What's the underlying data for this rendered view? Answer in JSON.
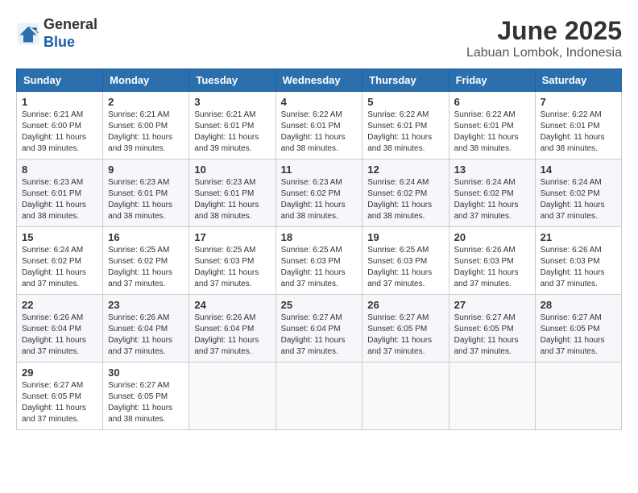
{
  "header": {
    "logo_line1": "General",
    "logo_line2": "Blue",
    "month_year": "June 2025",
    "location": "Labuan Lombok, Indonesia"
  },
  "weekdays": [
    "Sunday",
    "Monday",
    "Tuesday",
    "Wednesday",
    "Thursday",
    "Friday",
    "Saturday"
  ],
  "weeks": [
    [
      {
        "day": "1",
        "info": "Sunrise: 6:21 AM\nSunset: 6:00 PM\nDaylight: 11 hours\nand 39 minutes."
      },
      {
        "day": "2",
        "info": "Sunrise: 6:21 AM\nSunset: 6:00 PM\nDaylight: 11 hours\nand 39 minutes."
      },
      {
        "day": "3",
        "info": "Sunrise: 6:21 AM\nSunset: 6:01 PM\nDaylight: 11 hours\nand 39 minutes."
      },
      {
        "day": "4",
        "info": "Sunrise: 6:22 AM\nSunset: 6:01 PM\nDaylight: 11 hours\nand 38 minutes."
      },
      {
        "day": "5",
        "info": "Sunrise: 6:22 AM\nSunset: 6:01 PM\nDaylight: 11 hours\nand 38 minutes."
      },
      {
        "day": "6",
        "info": "Sunrise: 6:22 AM\nSunset: 6:01 PM\nDaylight: 11 hours\nand 38 minutes."
      },
      {
        "day": "7",
        "info": "Sunrise: 6:22 AM\nSunset: 6:01 PM\nDaylight: 11 hours\nand 38 minutes."
      }
    ],
    [
      {
        "day": "8",
        "info": "Sunrise: 6:23 AM\nSunset: 6:01 PM\nDaylight: 11 hours\nand 38 minutes."
      },
      {
        "day": "9",
        "info": "Sunrise: 6:23 AM\nSunset: 6:01 PM\nDaylight: 11 hours\nand 38 minutes."
      },
      {
        "day": "10",
        "info": "Sunrise: 6:23 AM\nSunset: 6:01 PM\nDaylight: 11 hours\nand 38 minutes."
      },
      {
        "day": "11",
        "info": "Sunrise: 6:23 AM\nSunset: 6:02 PM\nDaylight: 11 hours\nand 38 minutes."
      },
      {
        "day": "12",
        "info": "Sunrise: 6:24 AM\nSunset: 6:02 PM\nDaylight: 11 hours\nand 38 minutes."
      },
      {
        "day": "13",
        "info": "Sunrise: 6:24 AM\nSunset: 6:02 PM\nDaylight: 11 hours\nand 37 minutes."
      },
      {
        "day": "14",
        "info": "Sunrise: 6:24 AM\nSunset: 6:02 PM\nDaylight: 11 hours\nand 37 minutes."
      }
    ],
    [
      {
        "day": "15",
        "info": "Sunrise: 6:24 AM\nSunset: 6:02 PM\nDaylight: 11 hours\nand 37 minutes."
      },
      {
        "day": "16",
        "info": "Sunrise: 6:25 AM\nSunset: 6:02 PM\nDaylight: 11 hours\nand 37 minutes."
      },
      {
        "day": "17",
        "info": "Sunrise: 6:25 AM\nSunset: 6:03 PM\nDaylight: 11 hours\nand 37 minutes."
      },
      {
        "day": "18",
        "info": "Sunrise: 6:25 AM\nSunset: 6:03 PM\nDaylight: 11 hours\nand 37 minutes."
      },
      {
        "day": "19",
        "info": "Sunrise: 6:25 AM\nSunset: 6:03 PM\nDaylight: 11 hours\nand 37 minutes."
      },
      {
        "day": "20",
        "info": "Sunrise: 6:26 AM\nSunset: 6:03 PM\nDaylight: 11 hours\nand 37 minutes."
      },
      {
        "day": "21",
        "info": "Sunrise: 6:26 AM\nSunset: 6:03 PM\nDaylight: 11 hours\nand 37 minutes."
      }
    ],
    [
      {
        "day": "22",
        "info": "Sunrise: 6:26 AM\nSunset: 6:04 PM\nDaylight: 11 hours\nand 37 minutes."
      },
      {
        "day": "23",
        "info": "Sunrise: 6:26 AM\nSunset: 6:04 PM\nDaylight: 11 hours\nand 37 minutes."
      },
      {
        "day": "24",
        "info": "Sunrise: 6:26 AM\nSunset: 6:04 PM\nDaylight: 11 hours\nand 37 minutes."
      },
      {
        "day": "25",
        "info": "Sunrise: 6:27 AM\nSunset: 6:04 PM\nDaylight: 11 hours\nand 37 minutes."
      },
      {
        "day": "26",
        "info": "Sunrise: 6:27 AM\nSunset: 6:05 PM\nDaylight: 11 hours\nand 37 minutes."
      },
      {
        "day": "27",
        "info": "Sunrise: 6:27 AM\nSunset: 6:05 PM\nDaylight: 11 hours\nand 37 minutes."
      },
      {
        "day": "28",
        "info": "Sunrise: 6:27 AM\nSunset: 6:05 PM\nDaylight: 11 hours\nand 37 minutes."
      }
    ],
    [
      {
        "day": "29",
        "info": "Sunrise: 6:27 AM\nSunset: 6:05 PM\nDaylight: 11 hours\nand 37 minutes."
      },
      {
        "day": "30",
        "info": "Sunrise: 6:27 AM\nSunset: 6:05 PM\nDaylight: 11 hours\nand 38 minutes."
      },
      {
        "day": "",
        "info": ""
      },
      {
        "day": "",
        "info": ""
      },
      {
        "day": "",
        "info": ""
      },
      {
        "day": "",
        "info": ""
      },
      {
        "day": "",
        "info": ""
      }
    ]
  ]
}
